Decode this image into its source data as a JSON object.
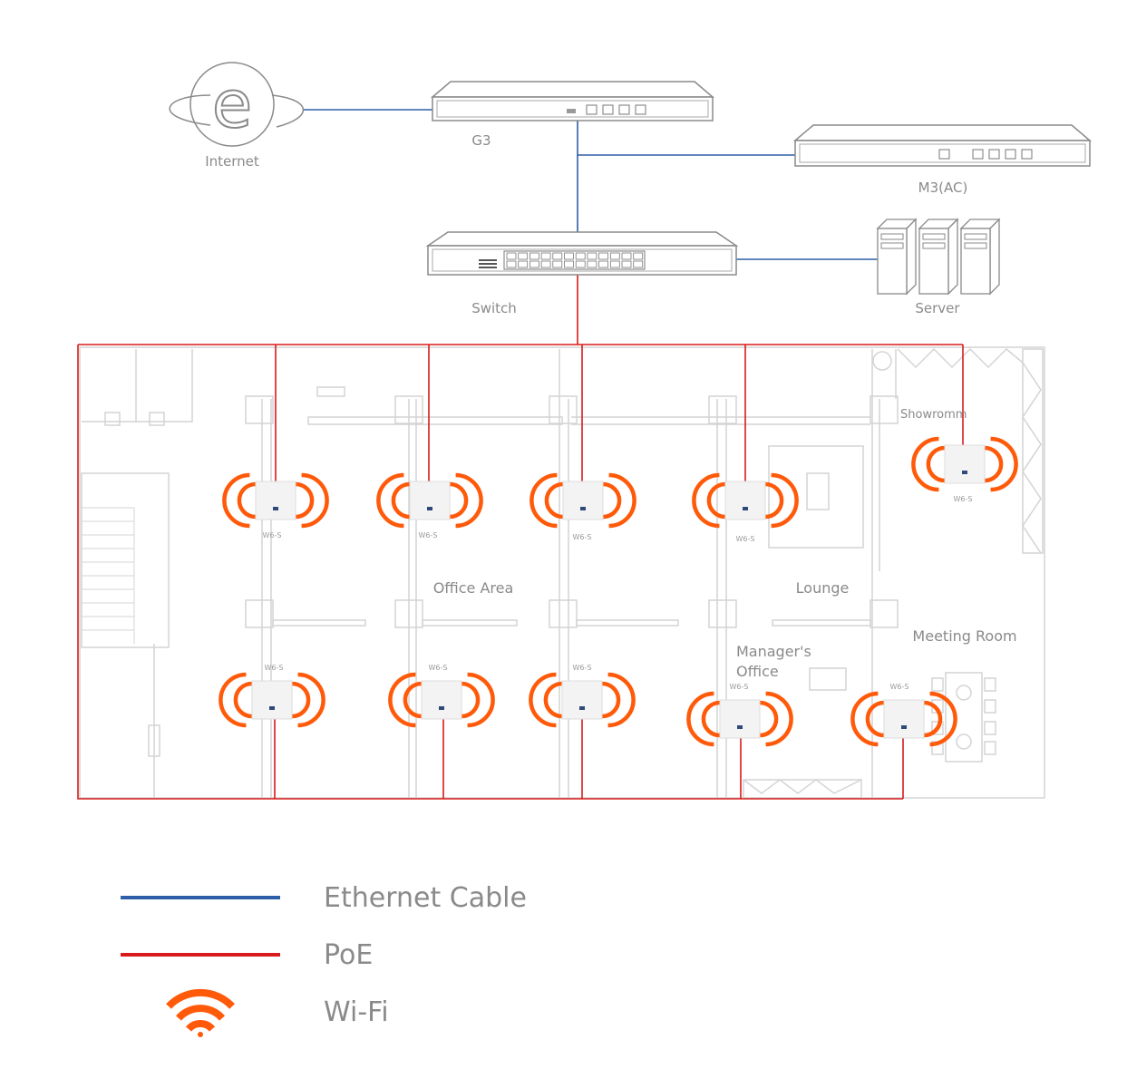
{
  "devices": {
    "internet": "Internet",
    "g3": "G3",
    "m3": "M3(AC)",
    "switch": "Switch",
    "server": "Server"
  },
  "rooms": {
    "office_area": "Office Area",
    "lounge": "Lounge",
    "showroom": "Showromm",
    "meeting_room": "Meeting Room",
    "managers_office_line1": "Manager's",
    "managers_office_line2": "Office"
  },
  "access_points": [
    {
      "model": "W6-S"
    },
    {
      "model": "W6-S"
    },
    {
      "model": "W6-S"
    },
    {
      "model": "W6-S"
    },
    {
      "model": "W6-S"
    },
    {
      "model": "W6-S"
    },
    {
      "model": "W6-S"
    },
    {
      "model": "W6-S"
    },
    {
      "model": "W6-S"
    },
    {
      "model": "W6-S"
    }
  ],
  "legend": {
    "ethernet": "Ethernet Cable",
    "poe": "PoE",
    "wifi": "Wi-Fi"
  },
  "colors": {
    "ethernet": "#2f5ea8",
    "poe": "#d91a1a",
    "wifi": "#ff5a0a",
    "device_outline": "#8a8a8a",
    "floorplan": "#d4d4d4"
  }
}
